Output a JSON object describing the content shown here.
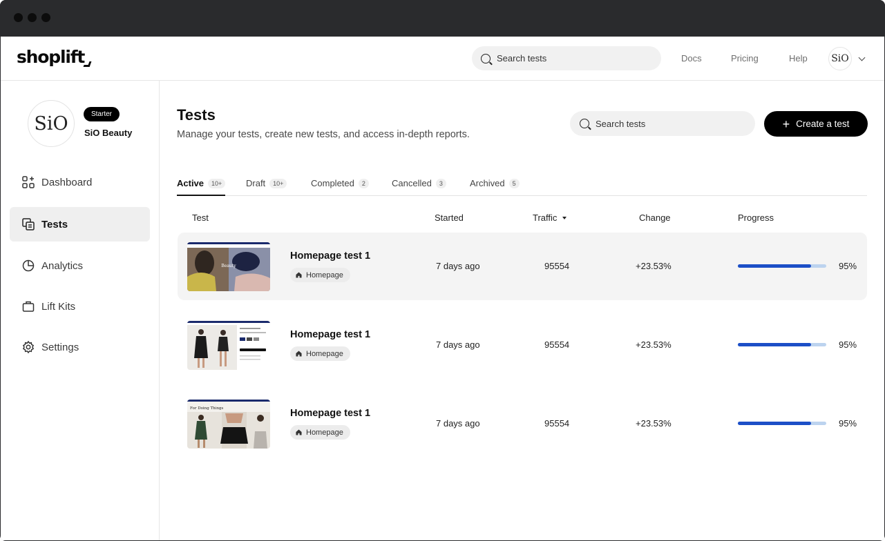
{
  "topbar": {
    "logo": "shoplift",
    "search_placeholder": "Search tests",
    "links": [
      "Docs",
      "Pricing",
      "Help"
    ],
    "avatar_text": "SiO"
  },
  "sidebar": {
    "brand_avatar_text": "SiO",
    "plan_badge": "Starter",
    "brand_name": "SiO Beauty",
    "items": [
      {
        "label": "Dashboard",
        "icon": "dashboard-icon"
      },
      {
        "label": "Tests",
        "icon": "tests-icon",
        "active": true
      },
      {
        "label": "Analytics",
        "icon": "analytics-icon"
      },
      {
        "label": "Lift Kits",
        "icon": "briefcase-icon"
      },
      {
        "label": "Settings",
        "icon": "gear-icon"
      }
    ]
  },
  "main": {
    "title": "Tests",
    "subtitle": "Manage your tests, create new tests, and access in-depth reports.",
    "search_placeholder": "Search tests",
    "create_button": "Create a test",
    "tabs": [
      {
        "label": "Active",
        "count": "10+",
        "active": true
      },
      {
        "label": "Draft",
        "count": "10+"
      },
      {
        "label": "Completed",
        "count": "2"
      },
      {
        "label": "Cancelled",
        "count": "3"
      },
      {
        "label": "Archived",
        "count": "5"
      }
    ],
    "columns": {
      "test": "Test",
      "started": "Started",
      "traffic": "Traffic",
      "change": "Change",
      "progress": "Progress"
    },
    "rows": [
      {
        "name": "Homepage test 1",
        "tag": "Homepage",
        "started": "7 days ago",
        "traffic": "95554",
        "change": "+23.53%",
        "progress": "95%",
        "progress_value": 0.83,
        "thumb_text": "Beauty"
      },
      {
        "name": "Homepage test 1",
        "tag": "Homepage",
        "started": "7 days ago",
        "traffic": "95554",
        "change": "+23.53%",
        "progress": "95%",
        "progress_value": 0.83,
        "thumb_text": ""
      },
      {
        "name": "Homepage test 1",
        "tag": "Homepage",
        "started": "7 days ago",
        "traffic": "95554",
        "change": "+23.53%",
        "progress": "95%",
        "progress_value": 0.83,
        "thumb_text": "For Doing Things"
      }
    ]
  },
  "colors": {
    "accent": "#1c4fc7",
    "progress_track": "#bcd3ef",
    "primary_button": "#000000",
    "highlight_row": "#f4f4f4"
  }
}
